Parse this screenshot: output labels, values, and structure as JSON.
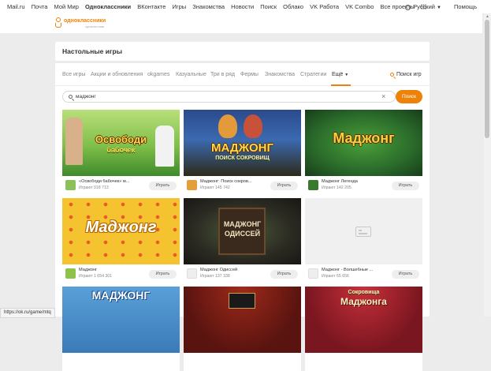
{
  "topbar": {
    "links": [
      "Mail.ru",
      "Почта",
      "Мой Мир",
      "Одноклассники",
      "ВКонтакте",
      "Игры",
      "Знакомства",
      "Новости",
      "Поиск",
      "Облако",
      "VK Работа",
      "VK Combo",
      "Все проекты"
    ],
    "active_link": "Одноклассники",
    "language": "Русский",
    "help": "Помощь"
  },
  "header": {
    "logo_text": "одноклассники",
    "logo_subtext": "одноклассники"
  },
  "page": {
    "title": "Настольные игры"
  },
  "tabs": {
    "items": [
      "Все игры",
      "Акции и обновления",
      "okgames",
      "Казуальные",
      "Три в ряд",
      "Фермы",
      "Знакомства",
      "Стратегии",
      "Ещё"
    ],
    "active": "Ещё",
    "search_tab": "Поиск игр"
  },
  "search": {
    "value": "маджонг",
    "button": "Поиск"
  },
  "play_label": "Играть",
  "games": [
    {
      "name": "«Освободи бабочек» м...",
      "players": "Играют 918 713",
      "art_title": "Освободи",
      "art_sub": "бабочек"
    },
    {
      "name": "Маджонг: Поиск сокров...",
      "players": "Играют 145 742",
      "art_title": "МАДЖОНГ",
      "art_sub": "ПОИСК СОКРОВИЩ"
    },
    {
      "name": "Маджонг Легенда",
      "players": "Играют 142 205",
      "art_title": "Маджонг",
      "art_sub": ""
    },
    {
      "name": "Маджонг",
      "players": "Играют 1 654 301",
      "art_title": "Маджонг",
      "art_sub": ""
    },
    {
      "name": "Маджонг Одиссей",
      "players": "Играют 137 338",
      "art_title": "МАДЖОНГ",
      "art_sub": "ОДИССЕЙ"
    },
    {
      "name": "Маджонг - Волшебные ...",
      "players": "Играют 65 656",
      "art_title": "",
      "art_sub": ""
    },
    {
      "name": "",
      "players": "",
      "art_title": "МАДЖОНГ",
      "art_sub": ""
    },
    {
      "name": "",
      "players": "",
      "art_title": "",
      "art_sub": ""
    },
    {
      "name": "",
      "players": "",
      "art_title": "Маджонга",
      "art_sub": "Сокровища"
    }
  ],
  "status_url": "https://ok.ru/game/mtq",
  "colors": {
    "accent": "#ee8208",
    "page_bg": "#ececec",
    "panel_bg": "#ffffff"
  },
  "icons": [
    "grid-icon",
    "globe-icon",
    "ok-logo-icon",
    "search-icon",
    "clear-icon",
    "image-placeholder-icon"
  ]
}
